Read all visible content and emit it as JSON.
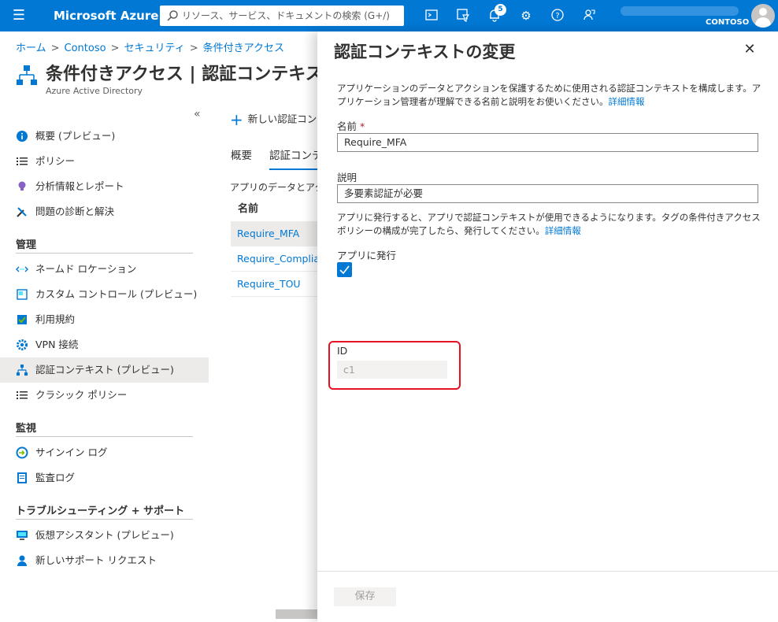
{
  "topbar": {
    "brand": "Microsoft Azure",
    "search_placeholder": "リソース、サービス、ドキュメントの検索 (G+/)",
    "notification_count": "5",
    "tenant": "CONTOSO"
  },
  "breadcrumb": [
    "ホーム",
    "Contoso",
    "セキュリティ",
    "条件付きアクセス"
  ],
  "header": {
    "title": "条件付きアクセス | 認証コンテキスト",
    "subtitle": "Azure Active Directory"
  },
  "sidebar": {
    "collapse": "«",
    "items_top": [
      {
        "label": "概要 (プレビュー)",
        "icon": "info-icon"
      },
      {
        "label": "ポリシー",
        "icon": "list-icon"
      },
      {
        "label": "分析情報とレポート",
        "icon": "lightbulb-icon"
      },
      {
        "label": "問題の診断と解決",
        "icon": "wrench-icon"
      }
    ],
    "section_manage": "管理",
    "items_manage": [
      {
        "label": "ネームド ロケーション",
        "icon": "location-icon"
      },
      {
        "label": "カスタム コントロール (プレビュー)",
        "icon": "custom-control-icon"
      },
      {
        "label": "利用規約",
        "icon": "terms-icon"
      },
      {
        "label": "VPN 接続",
        "icon": "gear-icon"
      },
      {
        "label": "認証コンテキスト (プレビュー)",
        "icon": "auth-context-icon"
      },
      {
        "label": "クラシック ポリシー",
        "icon": "list-icon"
      }
    ],
    "section_monitor": "監視",
    "items_monitor": [
      {
        "label": "サインイン ログ",
        "icon": "signin-log-icon"
      },
      {
        "label": "監査ログ",
        "icon": "audit-log-icon"
      }
    ],
    "section_support": "トラブルシューティング + サポート",
    "items_support": [
      {
        "label": "仮想アシスタント (プレビュー)",
        "icon": "assistant-icon"
      },
      {
        "label": "新しいサポート リクエスト",
        "icon": "support-icon"
      }
    ]
  },
  "main": {
    "new_button": "新しい認証コンテ",
    "tabs": [
      "概要",
      "認証コンテ"
    ],
    "desc": "アプリのデータとアクシ",
    "column_name": "名前",
    "rows": [
      "Require_MFA",
      "Require_Complian",
      "Require_TOU"
    ]
  },
  "panel": {
    "title": "認証コンテキストの変更",
    "description": "アプリケーションのデータとアクションを保護するために使用される認証コンテキストを構成します。アプリケーション管理者が理解できる名前と説明をお使いください。",
    "more_info": "詳細情報",
    "name_label": "名前",
    "required_mark": "*",
    "name_value": "Require_MFA",
    "desc_label": "説明",
    "desc_value": "多要素認証が必要",
    "publish_help": "アプリに発行すると、アプリで認証コンテキストが使用できるようになります。タグの条件付きアクセス ポリシーの構成が完了したら、発行してください。",
    "publish_more_info": "詳細情報",
    "publish_label": "アプリに発行",
    "publish_checked": true,
    "id_label": "ID",
    "id_value": "c1",
    "save_label": "保存"
  }
}
